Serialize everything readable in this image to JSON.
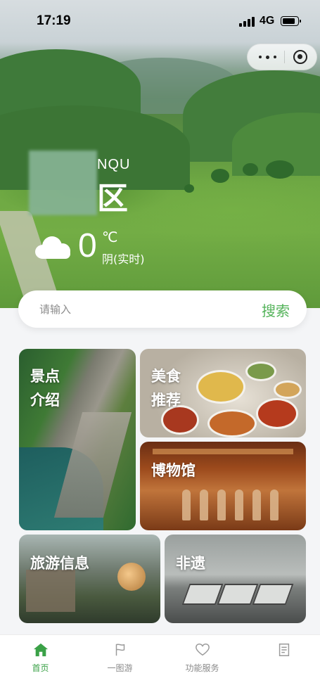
{
  "status_bar": {
    "time": "17:19",
    "network": "4G"
  },
  "hero": {
    "subtitle_fragment": "NQU",
    "title_fragment": "区",
    "weather": {
      "temperature": "0",
      "unit": "℃",
      "condition": "阴(实时)",
      "icon": "cloud-icon"
    }
  },
  "search": {
    "placeholder": "请输入",
    "button_label": "搜索"
  },
  "cards": [
    {
      "label": "景点\n介绍"
    },
    {
      "label": "美食\n推荐"
    },
    {
      "label": "博物馆"
    },
    {
      "label": "旅游信息"
    },
    {
      "label": "非遗"
    }
  ],
  "tabbar": {
    "items": [
      {
        "label": "首页",
        "icon": "home-icon",
        "active": true
      },
      {
        "label": "一图游",
        "icon": "flag-icon",
        "active": false
      },
      {
        "label": "功能服务",
        "icon": "heart-icon",
        "active": false
      },
      {
        "label": "",
        "icon": "document-icon",
        "active": false
      }
    ]
  },
  "colors": {
    "accent": "#54b35a",
    "tab_active": "#3aa147"
  }
}
